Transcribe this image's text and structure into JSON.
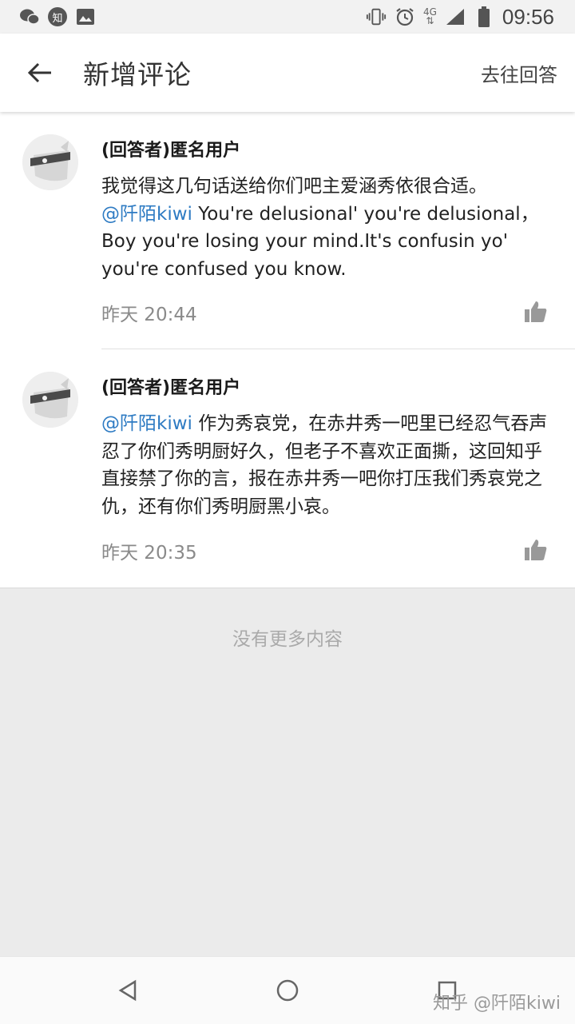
{
  "status_bar": {
    "time": "09:56",
    "network": "4G",
    "zhihu_badge": "知",
    "icons": [
      "wechat-icon",
      "zhihu-icon",
      "image-icon",
      "vibrate-icon",
      "alarm-icon",
      "signal-icon",
      "battery-icon"
    ]
  },
  "header": {
    "title": "新增评论",
    "action": "去往回答"
  },
  "comments": [
    {
      "author": "(回答者)匿名用户",
      "text": "我觉得这几句话送给你们吧主爱涵秀依很合适。",
      "mention": "@阡陌kiwi",
      "text_after": " You're delusional' you're delusional，Boy you're losing your mind.It's confusin yo' you're confused you know.",
      "time": "昨天 20:44"
    },
    {
      "author": "(回答者)匿名用户",
      "mention": "@阡陌kiwi",
      "text_after": " 作为秀哀党，在赤井秀一吧里已经忍气吞声忍了你们秀明厨好久，但老子不喜欢正面撕，这回知乎直接禁了你的言，报在赤井秀一吧你打压我们秀哀党之仇，还有你们秀明厨黑小哀。",
      "time": "昨天 20:35"
    }
  ],
  "footer": {
    "no_more": "没有更多内容",
    "watermark": "知乎 @阡陌kiwi"
  },
  "colors": {
    "mention": "#2e7bc3",
    "background": "#ebebeb"
  }
}
